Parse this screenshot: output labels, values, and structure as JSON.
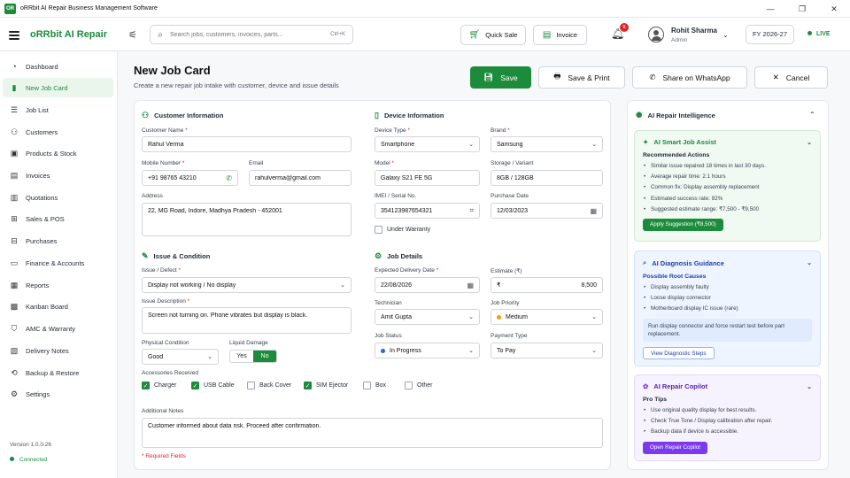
{
  "window": {
    "title": "oRRbit AI Repair Business Management Software",
    "logo": "OR",
    "controls": [
      "—",
      "❐",
      "✕"
    ]
  },
  "topbar": {
    "brand": "oRRbit AI Repair",
    "search_placeholder": "Search jobs, customers, invoices, parts...",
    "search_shortcut": "Ctrl+K",
    "quick_sale": "Quick Sale",
    "invoice": "Invoice",
    "notifications": "8",
    "user_name": "Rohit Sharma",
    "user_role": "Admin",
    "fiscal_year": "FY 2026-27",
    "status": "LIVE"
  },
  "sidebar": {
    "items": [
      {
        "label": "Dashboard",
        "icon": "speedometer-icon"
      },
      {
        "label": "New Job Card",
        "icon": "clipboard-icon",
        "active": true
      },
      {
        "label": "Job List",
        "icon": "list-icon"
      },
      {
        "label": "Customers",
        "icon": "users-icon"
      },
      {
        "label": "Products & Stock",
        "icon": "box-icon"
      },
      {
        "label": "Invoices",
        "icon": "receipt-icon"
      },
      {
        "label": "Quotations",
        "icon": "quote-icon"
      },
      {
        "label": "Sales & POS",
        "icon": "cart-icon"
      },
      {
        "label": "Purchases",
        "icon": "bag-icon"
      },
      {
        "label": "Finance & Accounts",
        "icon": "wallet-icon"
      },
      {
        "label": "Reports",
        "icon": "report-icon"
      },
      {
        "label": "Kanban Board",
        "icon": "kanban-icon"
      },
      {
        "label": "AMC & Warranty",
        "icon": "shield-icon"
      },
      {
        "label": "Delivery Notes",
        "icon": "note-icon"
      },
      {
        "label": "Backup & Restore",
        "icon": "backup-icon"
      },
      {
        "label": "Settings",
        "icon": "gear-icon"
      }
    ],
    "version": "Version 1.0.0.26",
    "connection": "Connected"
  },
  "page": {
    "title": "New Job Card",
    "subtitle": "Create a new repair job intake with customer, device and issue details",
    "save": "Save",
    "save_print": "Save & Print",
    "share": "Share on WhatsApp",
    "cancel": "Cancel"
  },
  "customer": {
    "heading": "Customer Information",
    "name_label": "Customer Name",
    "name": "Rahul Verma",
    "mobile_label": "Mobile Number",
    "mobile": "+91 98765 43210",
    "email_label": "Email",
    "email": "rahulverma@gmail.com",
    "address_label": "Address",
    "address": "22, MG Road, Indore, Madhya Pradesh - 452001"
  },
  "device": {
    "heading": "Device Information",
    "type_label": "Device Type",
    "type": "Smartphone",
    "brand_label": "Brand",
    "brand": "Samsung",
    "model_label": "Model",
    "model": "Galaxy S21 FE 5G",
    "storage_label": "Storage / Variant",
    "storage": "8GB / 128GB",
    "imei_label": "IMEI / Serial No.",
    "imei": "354123987654321",
    "purchase_label": "Purchase Date",
    "purchase": "12/03/2023",
    "warranty": "Under Warranty"
  },
  "issue": {
    "heading": "Issue & Condition",
    "defect_label": "Issue / Defect",
    "defect": "Display not working / No display",
    "desc_label": "Issue Description",
    "desc": "Screen not turning on. Phone vibrates but display is black.",
    "condition_label": "Physical Condition",
    "condition": "Good",
    "liquid_label": "Liquid Damage",
    "yes": "Yes",
    "no": "No",
    "accessories_label": "Accessories Received",
    "accessories": [
      {
        "label": "Charger",
        "checked": true
      },
      {
        "label": "USB Cable",
        "checked": true
      },
      {
        "label": "Back Cover",
        "checked": false
      },
      {
        "label": "SIM Ejector",
        "checked": true
      },
      {
        "label": "Box",
        "checked": false
      },
      {
        "label": "Other",
        "checked": false
      }
    ],
    "notes_label": "Additional Notes",
    "notes": "Customer informed about data risk. Proceed after confirmation.",
    "required_note": "* Required Fields"
  },
  "job": {
    "heading": "Job Details",
    "delivery_label": "Expected Delivery Date",
    "delivery": "22/08/2026",
    "estimate_label": "Estimate (₹)",
    "currency": "₹",
    "estimate": "8,500",
    "tech_label": "Technician",
    "tech": "Amit Gupta",
    "priority_label": "Job Priority",
    "priority": "Medium",
    "status_label": "Job Status",
    "status": "In Progress",
    "payment_label": "Payment Type",
    "payment": "To Pay",
    "priority_color": "#f59e0b",
    "status_color": "#2563eb"
  },
  "ai": {
    "heading": "AI Repair Intelligence",
    "assist": {
      "title": "AI Smart Job Assist",
      "sub": "Recommended Actions",
      "items": [
        "Similar issue repaired 18 times in last 30 days.",
        "Average repair time: 2.1 hours",
        "Common fix: Display assembly replacement",
        "Estimated success rate: 92%",
        "Suggested estimate range: ₹7,500 - ₹9,500"
      ],
      "button": "Apply Suggestion (₹8,500)"
    },
    "diagnosis": {
      "title": "AI Diagnosis Guidance",
      "sub": "Possible Root Causes",
      "items": [
        "Display assembly faulty",
        "Loose display connector",
        "Motherboard display IC issue (rare)"
      ],
      "note": "Run display connector and force restart test before part replacement.",
      "button": "View Diagnostic Steps"
    },
    "copilot": {
      "title": "AI Repair Copilot",
      "sub": "Pro Tips",
      "items": [
        "Use original quality display for best results.",
        "Check True Tone / Display calibration after repair.",
        "Backup data if device is accessible."
      ],
      "button": "Open Repair Copilot"
    }
  },
  "colors": {
    "brand": "#1d8b3c",
    "diagnosis": "#2563eb",
    "copilot": "#7c3aed"
  }
}
